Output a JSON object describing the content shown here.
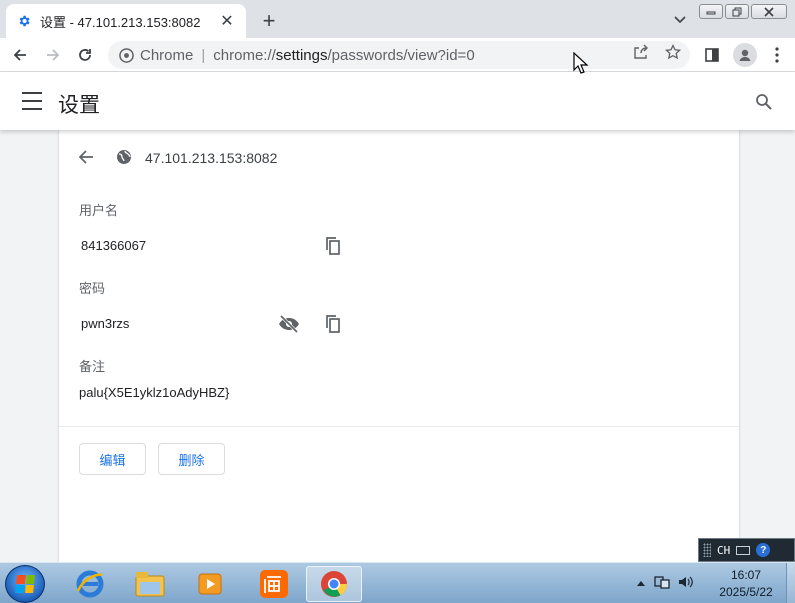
{
  "browser": {
    "tab": {
      "title": "设置 - 47.101.213.153:8082",
      "icon": "gear-icon",
      "close": "✕"
    },
    "new_tab": "+",
    "address": {
      "chip": "Chrome",
      "url_scheme": "chrome://",
      "url_host": "settings",
      "url_path": "/passwords/view?id=0"
    }
  },
  "settings": {
    "title": "设置",
    "entry": {
      "site": "47.101.213.153:8082",
      "username_label": "用户名",
      "username": "841366067",
      "password_label": "密码",
      "password": "pwn3rzs",
      "note_label": "备注",
      "note": "palu{X5E1yklz1oAdyHBZ}",
      "edit_label": "编辑",
      "delete_label": "删除"
    }
  },
  "langbar": {
    "lang": "CH",
    "help": "?"
  },
  "taskbar": {
    "time": "16:07",
    "date": "2025/5/22"
  },
  "colors": {
    "accent": "#1a73e8",
    "header_bg": "#ffffff",
    "page_bg": "#f1f3f4"
  }
}
